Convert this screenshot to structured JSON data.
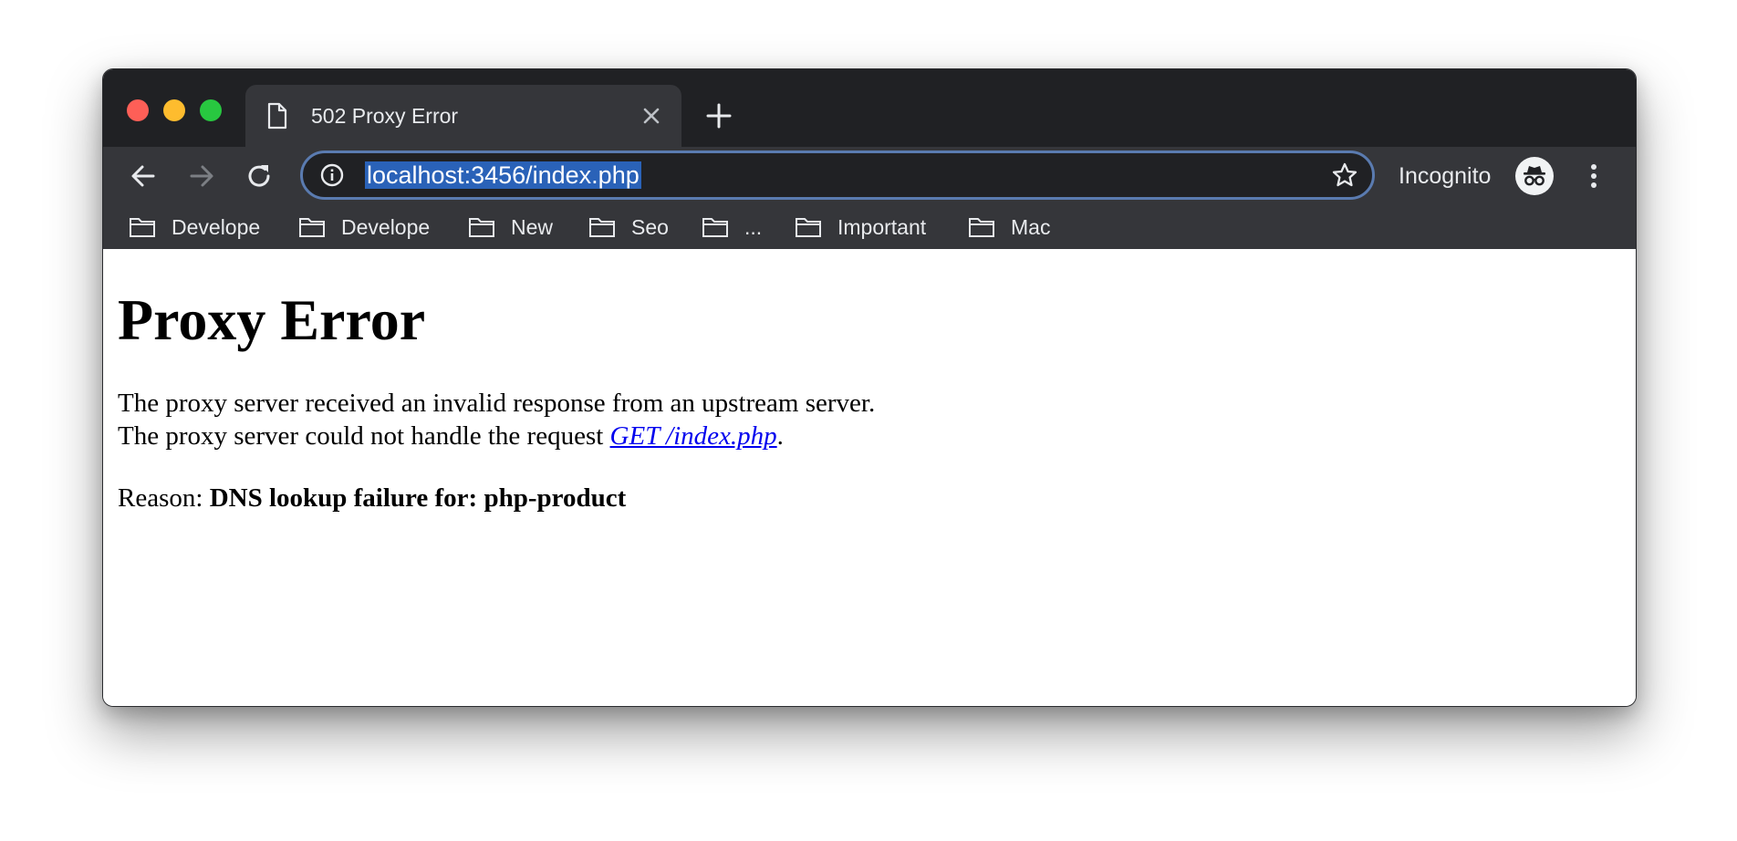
{
  "browser": {
    "tab": {
      "title": "502 Proxy Error"
    },
    "address_bar": {
      "url": "localhost:3456/index.php"
    },
    "profile": {
      "label": "Incognito"
    },
    "bookmarks": [
      {
        "label": "Develope"
      },
      {
        "label": "Develope"
      },
      {
        "label": "New"
      },
      {
        "label": "Seo"
      },
      {
        "label": "..."
      },
      {
        "label": "Important"
      },
      {
        "label": "Mac"
      }
    ],
    "colors": {
      "titlebar": "#202124",
      "toolbar": "#35363a",
      "url_selection": "#2a62b8",
      "link": "#0000ee"
    }
  },
  "page": {
    "heading": "Proxy Error",
    "line1": "The proxy server received an invalid response from an upstream server.",
    "line2_prefix": "The proxy server could not handle the request ",
    "line2_link": "GET /index.php",
    "line2_suffix": ".",
    "reason_label": "Reason: ",
    "reason_value": "DNS lookup failure for: php-product"
  }
}
